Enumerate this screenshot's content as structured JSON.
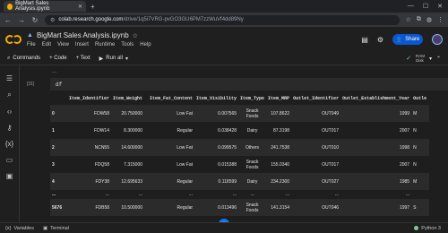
{
  "browser": {
    "tab_title": "BigMart Sales Analysis.ipynb",
    "url_domain": "colab.research.google.com",
    "url_path": "/drive/1q5i7VRG-pvGO3GU6PM7zzWuVf4dd89Ny"
  },
  "colab": {
    "notebook_title": "BigMart Sales Analysis.ipynb",
    "menu": [
      "File",
      "Edit",
      "View",
      "Insert",
      "Runtime",
      "Tools",
      "Help"
    ],
    "share_label": "Share",
    "toolbar": {
      "commands": "Commands",
      "code": "+ Code",
      "text": "+ Text",
      "run_all": "Run all",
      "ram": "RAM",
      "disk": "Disk"
    }
  },
  "cell": {
    "exec_count": "[31]",
    "code": "df",
    "collapsed_marker": "..."
  },
  "table": {
    "columns": [
      "",
      "Item_Identifier",
      "Item_Weight",
      "Item_Fat_Content",
      "Item_Visibility",
      "Item_Type",
      "Item_MRP",
      "Outlet_Identifier",
      "Outlet_Establishment_Year",
      "Outle"
    ],
    "rows": [
      {
        "idx": "0",
        "cells": [
          "FDW58",
          "20.750000",
          "Low Fat",
          "0.007565",
          "Snack Foods",
          "107.8622",
          "OUT049",
          "1999",
          "M"
        ]
      },
      {
        "idx": "1",
        "cells": [
          "FDW14",
          "8.300000",
          "Regular",
          "0.038428",
          "Dairy",
          "87.3198",
          "OUT017",
          "2007",
          "N"
        ]
      },
      {
        "idx": "2",
        "cells": [
          "NCN55",
          "14.600000",
          "Low Fat",
          "0.099575",
          "Others",
          "241.7538",
          "OUT010",
          "1998",
          "N"
        ]
      },
      {
        "idx": "3",
        "cells": [
          "FDQ58",
          "7.315000",
          "Low Fat",
          "0.015388",
          "Snack Foods",
          "155.0340",
          "OUT017",
          "2007",
          "N"
        ]
      },
      {
        "idx": "4",
        "cells": [
          "FDY38",
          "12.695633",
          "Regular",
          "0.118599",
          "Dairy",
          "234.2300",
          "OUT027",
          "1985",
          "M"
        ]
      },
      {
        "idx": "...",
        "cells": [
          "...",
          "...",
          "...",
          "...",
          "...",
          "...",
          "...",
          "...",
          ""
        ]
      },
      {
        "idx": "5676",
        "cells": [
          "FDB58",
          "10.500000",
          "Regular",
          "0.013496",
          "Snack Foods",
          "141.3154",
          "OUT046",
          "1997",
          "S"
        ]
      }
    ]
  },
  "statusbar": {
    "variables": "Variables",
    "terminal": "Terminal",
    "runtime": "Python 3"
  }
}
